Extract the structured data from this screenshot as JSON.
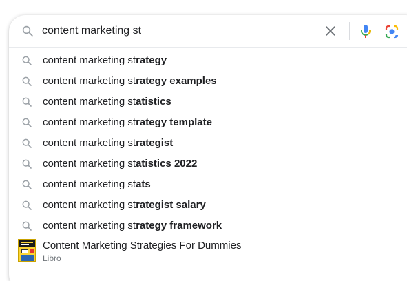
{
  "search": {
    "query": "content marketing st",
    "icons": {
      "leading": "search-icon",
      "clear": "close-icon",
      "voice": "microphone-icon",
      "lens": "google-lens-camera-icon"
    }
  },
  "suggestions": [
    {
      "typed": "content marketing st",
      "completion": "rategy"
    },
    {
      "typed": "content marketing st",
      "completion": "rategy examples"
    },
    {
      "typed": "content marketing st",
      "completion": "atistics"
    },
    {
      "typed": "content marketing st",
      "completion": "rategy template"
    },
    {
      "typed": "content marketing st",
      "completion": "rategist"
    },
    {
      "typed": "content marketing st",
      "completion": "atistics 2022"
    },
    {
      "typed": "content marketing st",
      "completion": "ats"
    },
    {
      "typed": "content marketing st",
      "completion": "rategist salary"
    },
    {
      "typed": "content marketing st",
      "completion": "rategy framework"
    }
  ],
  "entity": {
    "title": "Content Marketing Strategies For Dummies",
    "subtitle": "Libro",
    "thumbnail": "book-cover"
  },
  "colors": {
    "mic_blue": "#4285f4",
    "mic_red": "#ea4335",
    "mic_yellow": "#fbbc04",
    "mic_green": "#34a853",
    "icon_gray": "#9aa0a6"
  }
}
